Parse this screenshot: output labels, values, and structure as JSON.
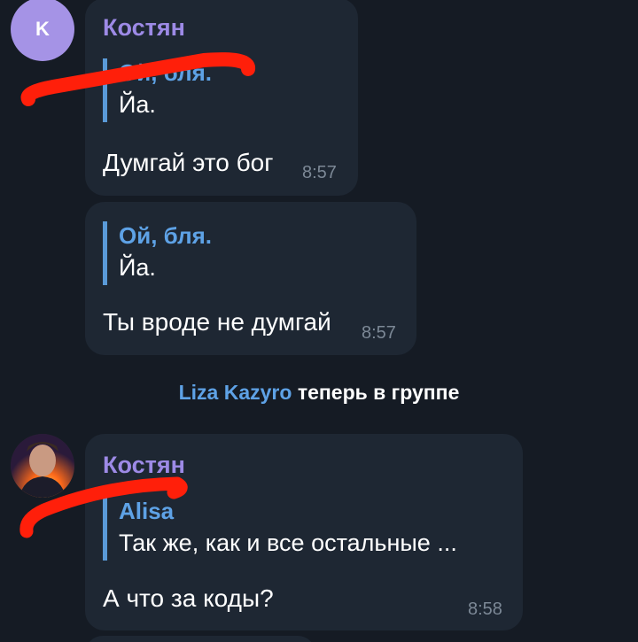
{
  "messages": [
    {
      "sender": "Костян",
      "avatar_letter": "K",
      "reply_name": "Ой, бля.",
      "reply_text": "Йа.",
      "text": "Думгай это бог",
      "time": "8:57"
    },
    {
      "reply_name": "Ой, бля.",
      "reply_text": "Йа.",
      "text": "Ты вроде не думгай",
      "time": "8:57"
    },
    {
      "sender": "Костян",
      "reply_name": "Alisa",
      "reply_text": "Так же, как и все остальные ...",
      "text": "А что за коды?",
      "time": "8:58"
    }
  ],
  "service": {
    "user": "Liza Kazyro",
    "text": " теперь в группе"
  },
  "colors": {
    "background": "#151b24",
    "bubble": "#1e2733",
    "sender": "#9d8ae6",
    "reply_accent": "#5ea2e6",
    "scribble": "#ff1f0a"
  }
}
